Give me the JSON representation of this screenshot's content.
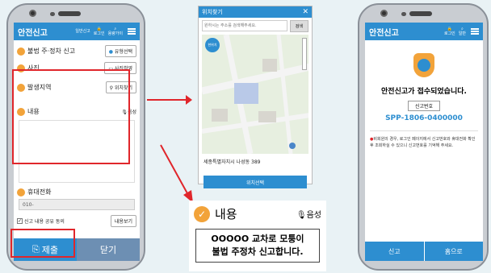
{
  "phone1": {
    "appbar": {
      "title": "안전신고",
      "tab1": "일반신고",
      "tab2": "로그인",
      "tab3": "용량가이",
      "tab3b": "원합니다"
    },
    "rows": {
      "illegal_parking": "불법 주·정차 신고",
      "type_select": "유형선택",
      "photo": "사진",
      "photo_btn": "사진촬영",
      "location": "발생지역",
      "location_btn": "위치찾기",
      "content": "내용",
      "voice": "음성",
      "phone": "휴대전화",
      "phone_value": "010-",
      "share": "신고 내용 공유 동의",
      "view_btn": "내용보기"
    },
    "bottom": {
      "submit": "제출",
      "close": "닫기"
    }
  },
  "map": {
    "title": "위치찾기",
    "search_placeholder": "원하시는 주소를 검색해주세요.",
    "search_btn": "검색",
    "pin_label": "현위치",
    "address": "세종특별자치시 나성동 389",
    "select_btn": "위치선택"
  },
  "zoom": {
    "label": "내용",
    "voice": "음성",
    "text_line1": "OOOOO 교차로 모퉁이",
    "text_line2": "불법 주정차 신고합니다."
  },
  "phone2": {
    "appbar": {
      "title": "안전신고",
      "tab1": "로그인",
      "tab2": "일반"
    },
    "message": "안전신고가 접수되었습니다.",
    "number_label": "신고번호",
    "number": "SPP-1806-0400000",
    "note": "비회원의 경우, 로그인 페이지에서 신고번호와 휴대전화 확인 후 조회하실 수 있으니 신고번호를 기억해 주세요.",
    "btn_report": "신고",
    "btn_home": "홈으로"
  }
}
